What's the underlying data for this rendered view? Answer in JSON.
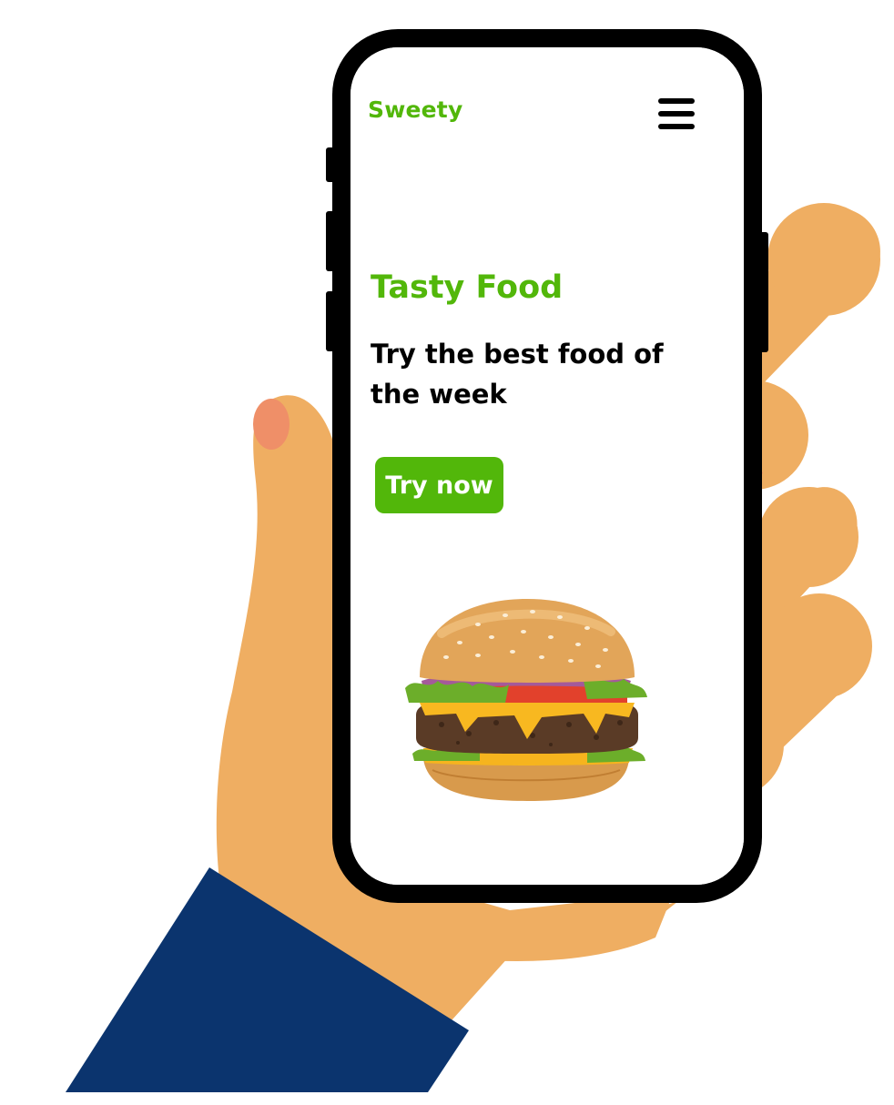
{
  "app": {
    "brand": "Sweety",
    "menu_icon": "hamburger-menu-icon"
  },
  "hero": {
    "title": "Tasty Food",
    "subtitle": "Try the best food of the week",
    "cta_label": "Try now",
    "image": "burger-image"
  },
  "colors": {
    "accent": "#52b70a",
    "text": "#000000",
    "skin": "#efae62",
    "nail": "#ef8f68",
    "sleeve": "#0b346e",
    "phone_frame": "#000000"
  }
}
